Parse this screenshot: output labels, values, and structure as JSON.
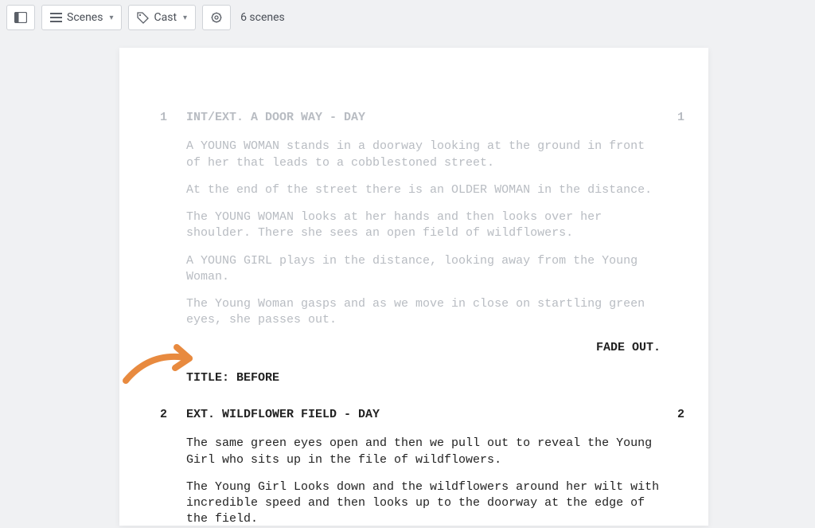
{
  "toolbar": {
    "scenes_label": "Scenes",
    "cast_label": "Cast",
    "scene_count_text": "6 scenes"
  },
  "script": {
    "scene1": {
      "number": "1",
      "heading": "INT/EXT. A DOOR WAY - DAY",
      "actions": [
        "A YOUNG WOMAN stands in a doorway looking at the ground in front of her that leads to a cobblestoned street.",
        "At the end of the street there is an OLDER WOMAN in the distance.",
        "The YOUNG WOMAN looks at her hands and then looks over her shoulder. There she sees an open field of wildflowers.",
        "A YOUNG GIRL plays in the distance, looking away from the Young Woman.",
        "The Young Woman gasps and as we move in close on startling green eyes, she passes out."
      ]
    },
    "transition1": "FADE OUT.",
    "title_card": "TITLE: BEFORE",
    "scene2": {
      "number": "2",
      "heading": "EXT. WILDFLOWER FIELD - DAY",
      "actions": [
        "The same green eyes open and then we pull out to reveal the Young Girl who sits up in the file of wildflowers.",
        "The Young Girl Looks down and the wildflowers around her wilt with incredible speed and then looks up to the doorway at the edge of the field."
      ]
    }
  },
  "annotation": {
    "arrow_color": "#e88a3f"
  }
}
